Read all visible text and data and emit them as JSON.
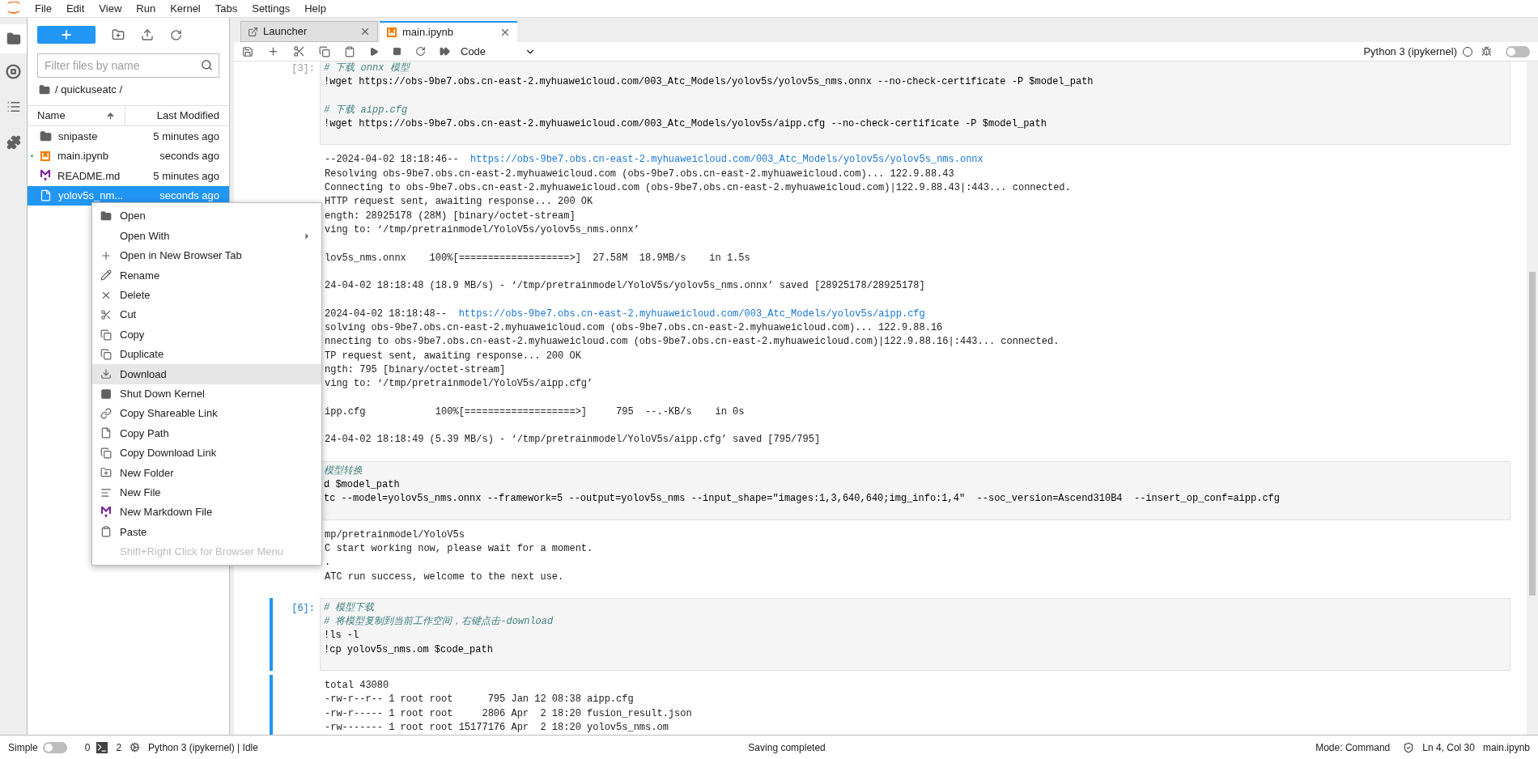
{
  "menubar": [
    "File",
    "Edit",
    "View",
    "Run",
    "Kernel",
    "Tabs",
    "Settings",
    "Help"
  ],
  "file_browser": {
    "filter_placeholder": "Filter files by name",
    "breadcrumb": "/ quickuseatc /",
    "columns": [
      {
        "label": "Name",
        "sorted": true
      },
      {
        "label": "Last Modified",
        "sorted": false
      }
    ],
    "files": [
      {
        "name": "snipaste",
        "modified": "5 minutes ago",
        "kind": "folder",
        "selected": false,
        "running": false
      },
      {
        "name": "main.ipynb",
        "modified": "seconds ago",
        "kind": "notebook",
        "selected": false,
        "running": true
      },
      {
        "name": "README.md",
        "modified": "5 minutes ago",
        "kind": "markdown",
        "selected": false,
        "running": false
      },
      {
        "name": "yolov5s_nm...",
        "modified": "seconds ago",
        "kind": "file",
        "selected": true,
        "running": false
      }
    ]
  },
  "context_menu": [
    {
      "label": "Open",
      "kind": "item",
      "highlighted": false,
      "submenu": false
    },
    {
      "label": "Open With",
      "kind": "item",
      "highlighted": false,
      "submenu": true
    },
    {
      "label": "Open in New Browser Tab",
      "kind": "item",
      "highlighted": false,
      "submenu": false
    },
    {
      "label": "Rename",
      "kind": "item",
      "highlighted": false,
      "submenu": false
    },
    {
      "label": "Delete",
      "kind": "item",
      "highlighted": false,
      "submenu": false
    },
    {
      "label": "Cut",
      "kind": "item",
      "highlighted": false,
      "submenu": false
    },
    {
      "label": "Copy",
      "kind": "item",
      "highlighted": false,
      "submenu": false
    },
    {
      "label": "Duplicate",
      "kind": "item",
      "highlighted": false,
      "submenu": false
    },
    {
      "label": "Download",
      "kind": "item",
      "highlighted": true,
      "submenu": false
    },
    {
      "label": "Shut Down Kernel",
      "kind": "item",
      "highlighted": false,
      "submenu": false
    },
    {
      "label": "Copy Shareable Link",
      "kind": "item",
      "highlighted": false,
      "submenu": false
    },
    {
      "label": "Copy Path",
      "kind": "item",
      "highlighted": false,
      "submenu": false
    },
    {
      "label": "Copy Download Link",
      "kind": "item",
      "highlighted": false,
      "submenu": false
    },
    {
      "label": "New Folder",
      "kind": "item",
      "highlighted": false,
      "submenu": false
    },
    {
      "label": "New File",
      "kind": "item",
      "highlighted": false,
      "submenu": false
    },
    {
      "label": "New Markdown File",
      "kind": "item",
      "highlighted": false,
      "submenu": false
    },
    {
      "label": "Paste",
      "kind": "item",
      "highlighted": false,
      "submenu": false
    },
    {
      "label": "Shift+Right Click for Browser Menu",
      "kind": "hint"
    }
  ],
  "tabs": [
    {
      "label": "Launcher",
      "kind": "launcher",
      "selected": false
    },
    {
      "label": "main.ipynb",
      "kind": "notebook",
      "selected": true
    }
  ],
  "notebook_toolbar": {
    "cell_type": "Code",
    "kernel": "Python 3 (ipykernel)",
    "kernel_busy": false,
    "debugger_on": false
  },
  "cells": [
    {
      "prompt": "[3]:",
      "selected": false,
      "input": [
        {
          "kind": "comment",
          "text": "# 下载 onnx 模型"
        },
        {
          "kind": "code",
          "text": "!wget https://obs-9be7.obs.cn-east-2.myhuaweicloud.com/003_Atc_Models/yolov5s/yolov5s_nms.onnx --no-check-certificate -P $model_path"
        },
        {
          "kind": "blank"
        },
        {
          "kind": "comment",
          "text": "# 下载 aipp.cfg"
        },
        {
          "kind": "code",
          "text": "!wget https://obs-9be7.obs.cn-east-2.myhuaweicloud.com/003_Atc_Models/yolov5s/aipp.cfg --no-check-certificate -P $model_path"
        }
      ],
      "output": [
        {
          "kind": "text",
          "text": "--2024-04-02 18:18:46--  ",
          "url": "https://obs-9be7.obs.cn-east-2.myhuaweicloud.com/003_Atc_Models/yolov5s/yolov5s_nms.onnx"
        },
        {
          "kind": "text",
          "text": "Resolving obs-9be7.obs.cn-east-2.myhuaweicloud.com (obs-9be7.obs.cn-east-2.myhuaweicloud.com)... 122.9.88.43"
        },
        {
          "kind": "text",
          "text": "Connecting to obs-9be7.obs.cn-east-2.myhuaweicloud.com (obs-9be7.obs.cn-east-2.myhuaweicloud.com)|122.9.88.43|:443... connected."
        },
        {
          "kind": "text",
          "text": "HTTP request sent, awaiting response... 200 OK"
        },
        {
          "kind": "text",
          "text": "ength: 28925178 (28M) [binary/octet-stream]"
        },
        {
          "kind": "text",
          "text": "ving to: ‘/tmp/pretrainmodel/YoloV5s/yolov5s_nms.onnx’"
        },
        {
          "kind": "blank"
        },
        {
          "kind": "text",
          "text": "lov5s_nms.onnx    100%[===================>]  27.58M  18.9MB/s    in 1.5s"
        },
        {
          "kind": "blank"
        },
        {
          "kind": "text",
          "text": "24-04-02 18:18:48 (18.9 MB/s) - ‘/tmp/pretrainmodel/YoloV5s/yolov5s_nms.onnx’ saved [28925178/28925178]"
        },
        {
          "kind": "blank"
        },
        {
          "kind": "text",
          "text": "2024-04-02 18:18:48--  ",
          "url": "https://obs-9be7.obs.cn-east-2.myhuaweicloud.com/003_Atc_Models/yolov5s/aipp.cfg"
        },
        {
          "kind": "text",
          "text": "solving obs-9be7.obs.cn-east-2.myhuaweicloud.com (obs-9be7.obs.cn-east-2.myhuaweicloud.com)... 122.9.88.16"
        },
        {
          "kind": "text",
          "text": "nnecting to obs-9be7.obs.cn-east-2.myhuaweicloud.com (obs-9be7.obs.cn-east-2.myhuaweicloud.com)|122.9.88.16|:443... connected."
        },
        {
          "kind": "text",
          "text": "TP request sent, awaiting response... 200 OK"
        },
        {
          "kind": "text",
          "text": "ngth: 795 [binary/octet-stream]"
        },
        {
          "kind": "text",
          "text": "ving to: ‘/tmp/pretrainmodel/YoloV5s/aipp.cfg’"
        },
        {
          "kind": "blank"
        },
        {
          "kind": "text",
          "text": "ipp.cfg            100%[===================>]     795  --.-KB/s    in 0s"
        },
        {
          "kind": "blank"
        },
        {
          "kind": "text",
          "text": "24-04-02 18:18:49 (5.39 MB/s) - ‘/tmp/pretrainmodel/YoloV5s/aipp.cfg’ saved [795/795]"
        }
      ]
    },
    {
      "selected": false,
      "input": [
        {
          "kind": "comment",
          "text": "模型转换"
        },
        {
          "kind": "code",
          "text": "d $model_path"
        },
        {
          "kind": "code",
          "text": "tc --model=yolov5s_nms.onnx --framework=5 --output=yolov5s_nms --input_shape=\"images:1,3,640,640;img_info:1,4\"  --soc_version=Ascend310B4  --insert_op_conf=aipp.cfg"
        }
      ],
      "output": [
        {
          "kind": "text",
          "text": "mp/pretrainmodel/YoloV5s"
        },
        {
          "kind": "text",
          "text": "C start working now, please wait for a moment."
        },
        {
          "kind": "text",
          "text": "."
        },
        {
          "kind": "text",
          "text": "ATC run success, welcome to the next use."
        }
      ]
    },
    {
      "prompt": "[6]:",
      "selected": true,
      "input": [
        {
          "kind": "comment",
          "text": "# 模型下载"
        },
        {
          "kind": "comment",
          "text": "# 将模型复制到当前工作空间，右键点击-download"
        },
        {
          "kind": "code",
          "text": "!ls -l"
        },
        {
          "kind": "code",
          "text": "!cp yolov5s_nms.om $code_path"
        }
      ],
      "output": [
        {
          "kind": "text",
          "text": "total 43080"
        },
        {
          "kind": "text",
          "text": "-rw-r--r-- 1 root root      795 Jan 12 08:38 aipp.cfg"
        },
        {
          "kind": "text",
          "text": "-rw-r----- 1 root root     2806 Apr  2 18:20 fusion_result.json"
        },
        {
          "kind": "text",
          "text": "-rw------- 1 root root 15177176 Apr  2 18:20 yolov5s_nms.om"
        }
      ]
    }
  ],
  "status_bar": {
    "simple_label": "Simple",
    "simple_on": false,
    "terminals": "0",
    "kernels": "2",
    "kernel_status": "Python 3 (ipykernel) | Idle",
    "message": "Saving completed",
    "mode": "Mode: Command",
    "cursor": "Ln 4, Col 30",
    "file": "main.ipynb"
  }
}
